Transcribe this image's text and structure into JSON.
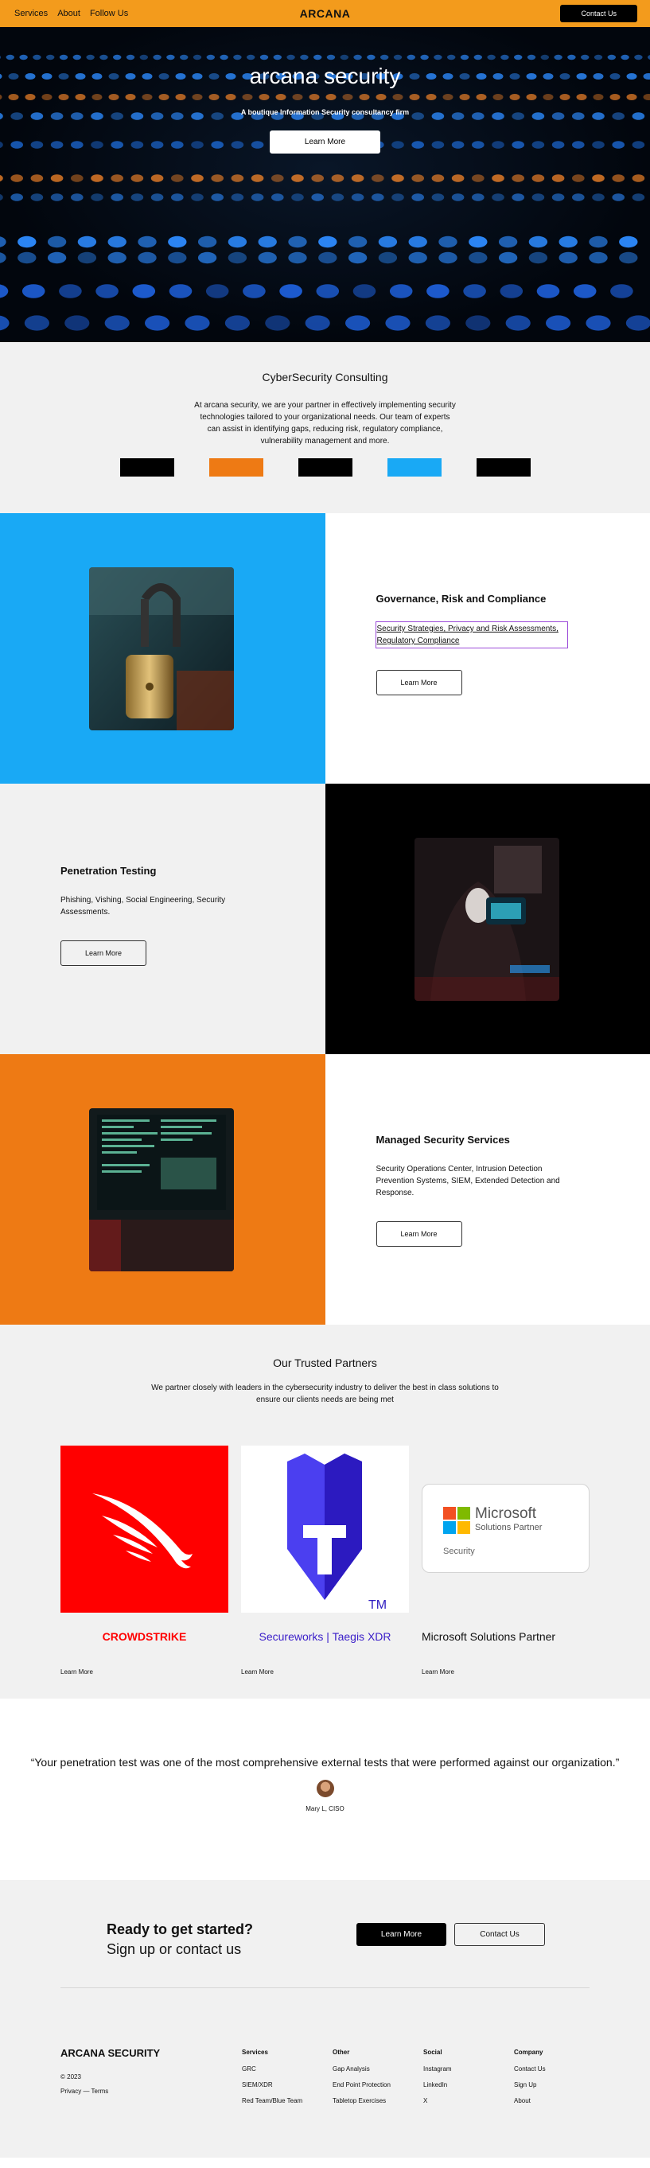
{
  "nav": {
    "links": [
      "Services",
      "About",
      "Follow Us"
    ],
    "brand": "ARCANA",
    "cta": "Contact Us"
  },
  "hero": {
    "title": "arcana security",
    "subtitle": "A boutique Information Security consultancy firm",
    "button": "Learn More"
  },
  "intro": {
    "heading": "CyberSecurity Consulting",
    "body": "At arcana security, we are your partner in effectively implementing security technologies tailored to your organizational needs. Our team of experts can assist in identifying gaps, reducing risk, regulatory compliance, vulnerability management and more.",
    "swatches": [
      "#000000",
      "#ee7a14",
      "#000000",
      "#19a9f5",
      "#000000"
    ]
  },
  "services": [
    {
      "title": "Governance, Risk and Compliance",
      "desc": "Security Strategies, Privacy and Risk Assessments, Regulatory Compliance",
      "button": "Learn More",
      "image_icon": "padlock-image",
      "color": "#19a9f5"
    },
    {
      "title": "Penetration Testing",
      "desc": "Phishing, Vishing, Social Engineering, Security Assessments.",
      "button": "Learn More",
      "image_icon": "hooded-hacker-image",
      "color": "#000000"
    },
    {
      "title": "Managed Security Services",
      "desc": "Security Operations Center, Intrusion Detection Prevention Systems, SIEM, Extended Detection and Response.",
      "button": "Learn More",
      "image_icon": "terminal-screen-image",
      "color": "#ee7a14"
    }
  ],
  "partners": {
    "heading": "Our Trusted Partners",
    "desc": "We partner closely with leaders in the cybersecurity industry to deliver the best in class solutions to ensure our clients needs are being met",
    "items": [
      {
        "name": "CROWDSTRIKE",
        "link": "Learn More",
        "color": "#ff0000"
      },
      {
        "name": "Secureworks | Taegis XDR",
        "link": "Learn More",
        "color": "#3a1ec9",
        "logo_text": "TM"
      },
      {
        "name": "Microsoft Solutions Partner",
        "link": "Learn More",
        "color": "#111111",
        "logo_title": "Microsoft",
        "logo_sub": "Solutions Partner",
        "logo_tag": "Security"
      }
    ]
  },
  "testimonial": {
    "quote": "Your penetration test was one of the most comprehensive external tests that were performed against our organization.",
    "author": "Mary L, CISO"
  },
  "footer": {
    "cta_title": "Ready to get started?",
    "cta_sub": "Sign up or contact us",
    "cta_primary": "Learn More",
    "cta_secondary": "Contact Us",
    "brand": "ARCANA SECURITY",
    "year": "© 2023",
    "legal": "Privacy — Terms",
    "columns": [
      {
        "head": "Services",
        "items": [
          "GRC",
          "SIEM/XDR",
          "Red Team/Blue Team"
        ]
      },
      {
        "head": "Other",
        "items": [
          "Gap Analysis",
          "End Point Protection",
          "Tabletop Exercises"
        ]
      },
      {
        "head": "Social",
        "items": [
          "Instagram",
          "LinkedIn",
          "X"
        ]
      },
      {
        "head": "Company",
        "items": [
          "Contact Us",
          "Sign Up",
          "About"
        ]
      }
    ]
  }
}
